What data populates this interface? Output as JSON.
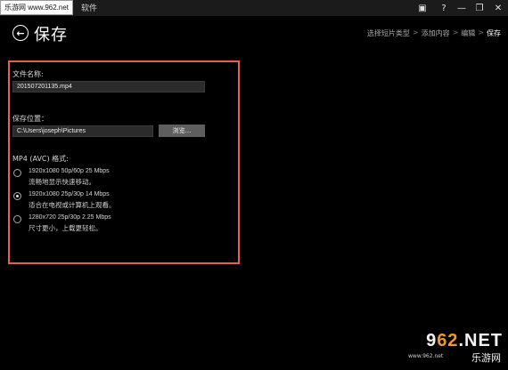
{
  "window": {
    "watermark": "乐游网 www.962.net",
    "title": "软件",
    "controls": [
      "briefcase-icon",
      "help-icon",
      "minimize-icon",
      "restore-icon",
      "close-icon"
    ],
    "control_glyphs": [
      "▣",
      "?",
      "—",
      "❐",
      "✕"
    ]
  },
  "header": {
    "back_glyph": "←",
    "title": "保存",
    "breadcrumbs": [
      "选择短片类型",
      "添加内容",
      "编辑",
      "保存"
    ],
    "separator": ">"
  },
  "form": {
    "filename_label": "文件名称:",
    "filename_value": "201507201135.mp4",
    "location_label": "保存位置：",
    "location_value": "C:\\Users\\joseph\\Pictures",
    "browse_label": "浏览...",
    "format_label": "MP4 (AVC) 格式:",
    "options": [
      {
        "spec": "1920x1080 50p/60p 25 Mbps",
        "desc": "流畅地显示快速移动。",
        "selected": false
      },
      {
        "spec": "1920x1080 25p/30p 14 Mbps",
        "desc": "适合在电视或计算机上观看。",
        "selected": true
      },
      {
        "spec": "1280x720 25p/30p 2.25 Mbps",
        "desc": "尺寸更小，上载更轻松。",
        "selected": false
      }
    ]
  },
  "brand": {
    "big_prefix": "9",
    "big_highlight": "62",
    "big_suffix": ".NET",
    "cn": "乐游网",
    "url": "www.962.net",
    "accent": "#f39a1a"
  },
  "colors": {
    "background": "#000000",
    "panel_border": "#e8604c",
    "field_bg": "#2b2b2b",
    "button_bg": "#5e5e5e"
  }
}
